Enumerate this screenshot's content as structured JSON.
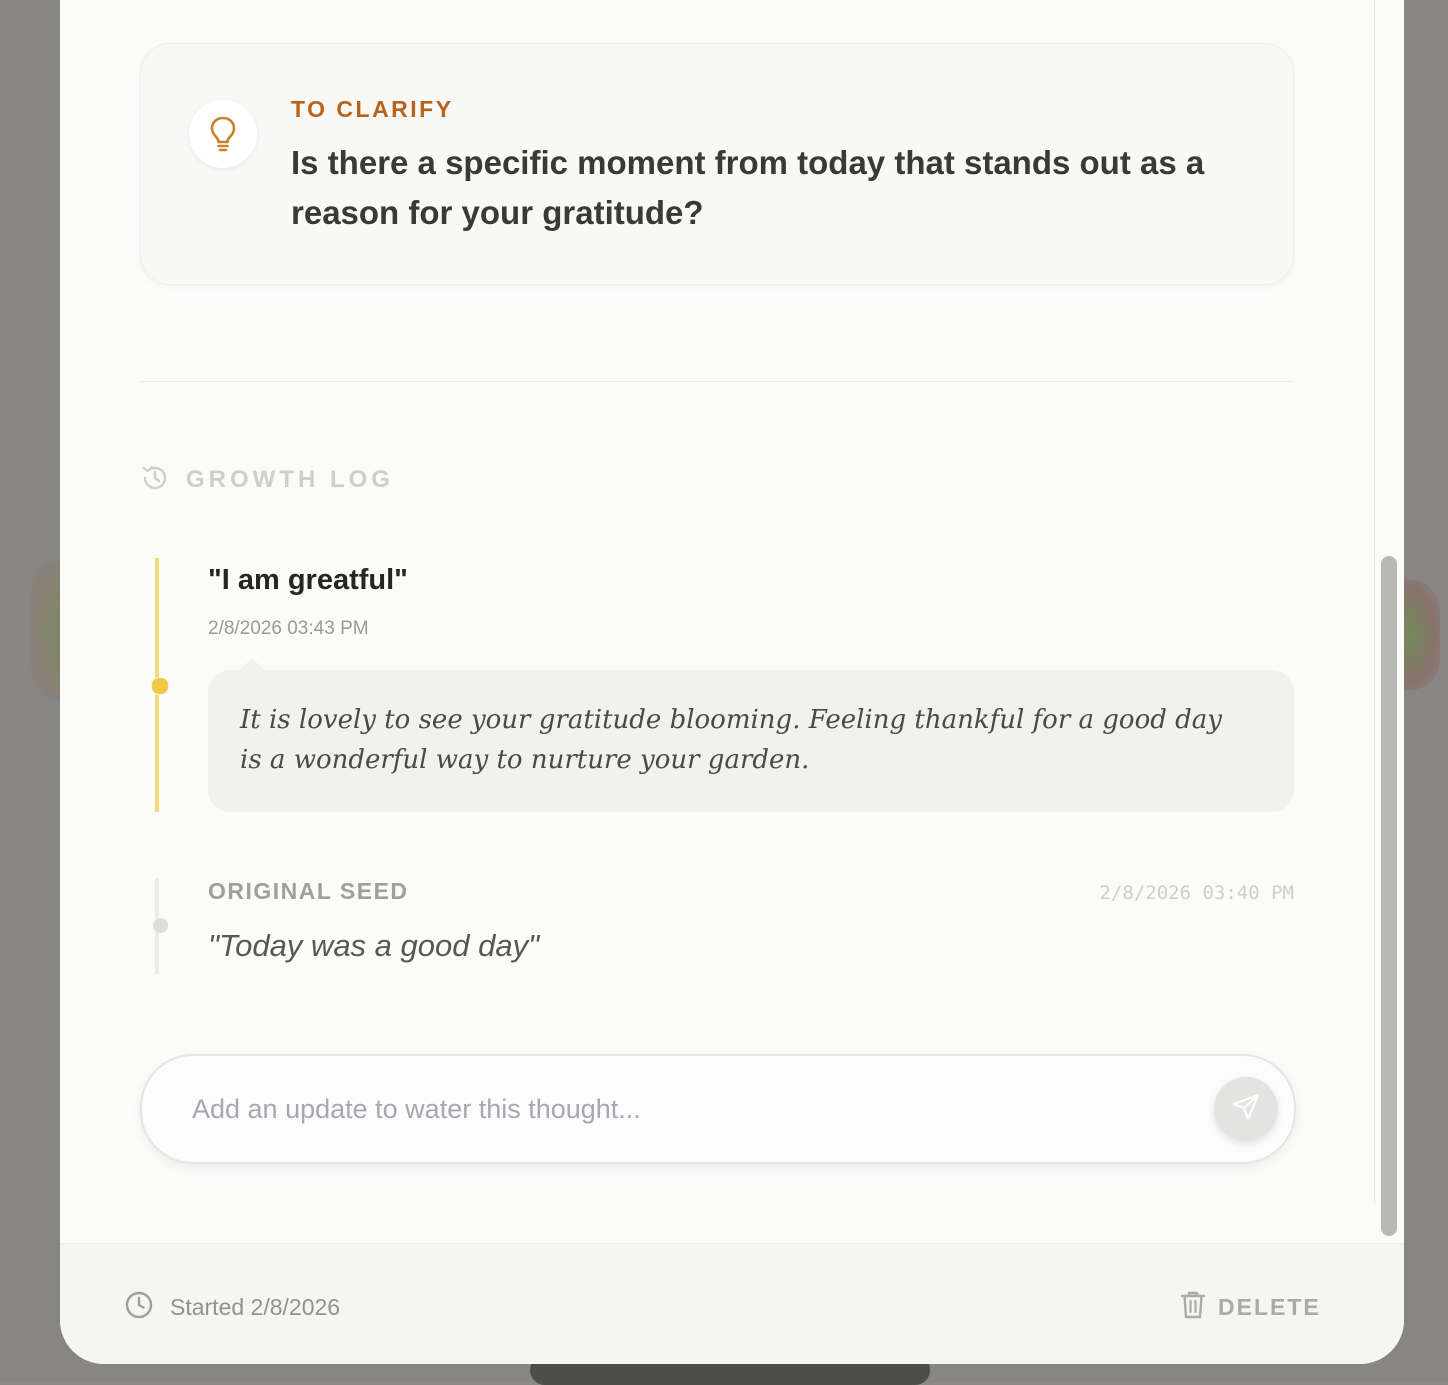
{
  "clarify": {
    "label": "TO CLARIFY",
    "question": "Is there a specific moment from today that stands out as a reason for your gratitude?",
    "icon": "lightbulb-icon",
    "accent_color": "#b8621a"
  },
  "growth_log": {
    "title": "GROWTH LOG",
    "icon": "history-icon",
    "entries": [
      {
        "title": "\"I am greatful\"",
        "date": "2/8/2026 03:43 PM",
        "reply": "It is lovely to see your gratitude blooming. Feeling thankful for a good day is a wonderful way to nurture your garden."
      }
    ],
    "seed": {
      "label": "ORIGINAL SEED",
      "date": "2/8/2026 03:40 PM",
      "text": "\"Today was a good day\""
    }
  },
  "update_input": {
    "placeholder": "Add an update to water this thought...",
    "value": "",
    "send_icon": "send-icon"
  },
  "footer": {
    "started": "Started 2/8/2026",
    "delete_label": "DELETE",
    "clock_icon": "clock-icon",
    "trash_icon": "trash-icon"
  }
}
